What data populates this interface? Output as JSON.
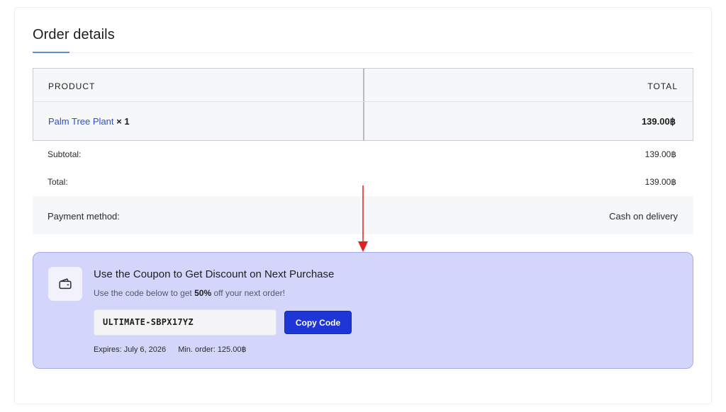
{
  "order": {
    "title": "Order details",
    "columns": {
      "product": "PRODUCT",
      "total": "TOTAL"
    },
    "items": [
      {
        "name": "Palm Tree Plant",
        "quantity": "× 1",
        "total": "139.00฿"
      }
    ],
    "subtotal": {
      "label": "Subtotal:",
      "value": "139.00฿"
    },
    "total": {
      "label": "Total:",
      "value": "139.00฿"
    },
    "payment": {
      "label": "Payment method:",
      "value": "Cash on delivery"
    }
  },
  "coupon": {
    "icon": "wallet-icon",
    "title": "Use the Coupon to Get Discount on Next Purchase",
    "desc_prefix": "Use the code below to get",
    "desc_discount": "50%",
    "desc_suffix": "off your next order!",
    "code": "ULTIMATE-SBPX17YZ",
    "copy_label": "Copy Code",
    "expires": "Expires: July 6, 2026",
    "min_order": "Min. order: 125.00฿"
  },
  "colors": {
    "link": "#2b4fc9",
    "coupon_bg": "#d3d5fb",
    "button": "#1f36d6",
    "arrow": "#e02020",
    "tab_underline": "#5a8fd6"
  }
}
